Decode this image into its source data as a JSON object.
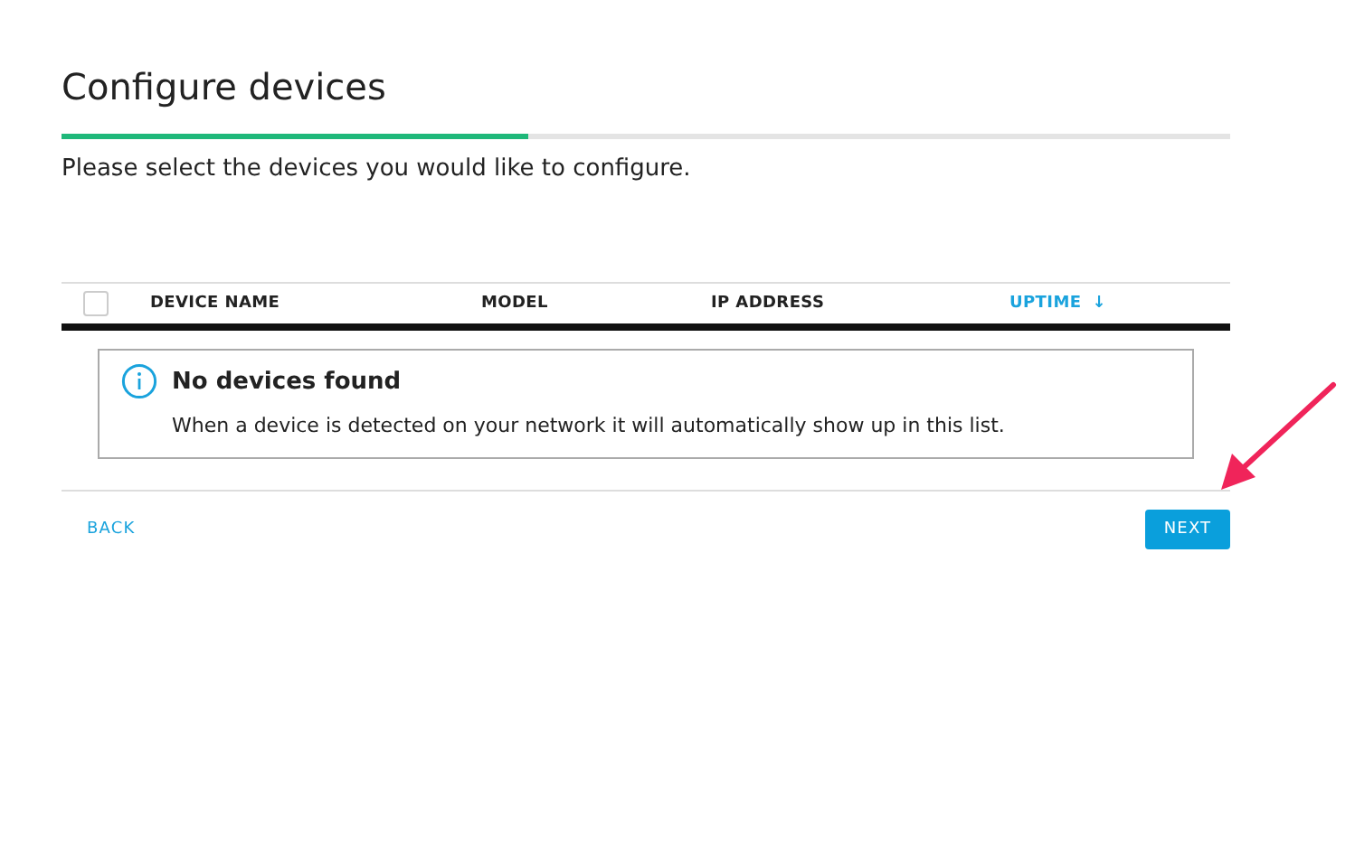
{
  "title": "Configure devices",
  "progress": {
    "level": 0.4
  },
  "description": "Please select the devices you would like to configure.",
  "table": {
    "select_all": {
      "checked": false
    },
    "columns": [
      {
        "label": "DEVICE NAME",
        "sorted": false
      },
      {
        "label": "MODEL",
        "sorted": false
      },
      {
        "label": "IP ADDRESS",
        "sorted": false
      },
      {
        "label": "UPTIME",
        "sorted": true,
        "sort_indicator": "↓"
      }
    ]
  },
  "empty_message": {
    "title": "No devices found",
    "text": "When a device is detected on your network it will automatically show up in this list."
  },
  "buttons": [
    {
      "label": "BACK",
      "kind": "link"
    },
    {
      "label": "NEXT",
      "kind": "primary"
    }
  ],
  "annotation": {
    "kind": "arrow"
  }
}
